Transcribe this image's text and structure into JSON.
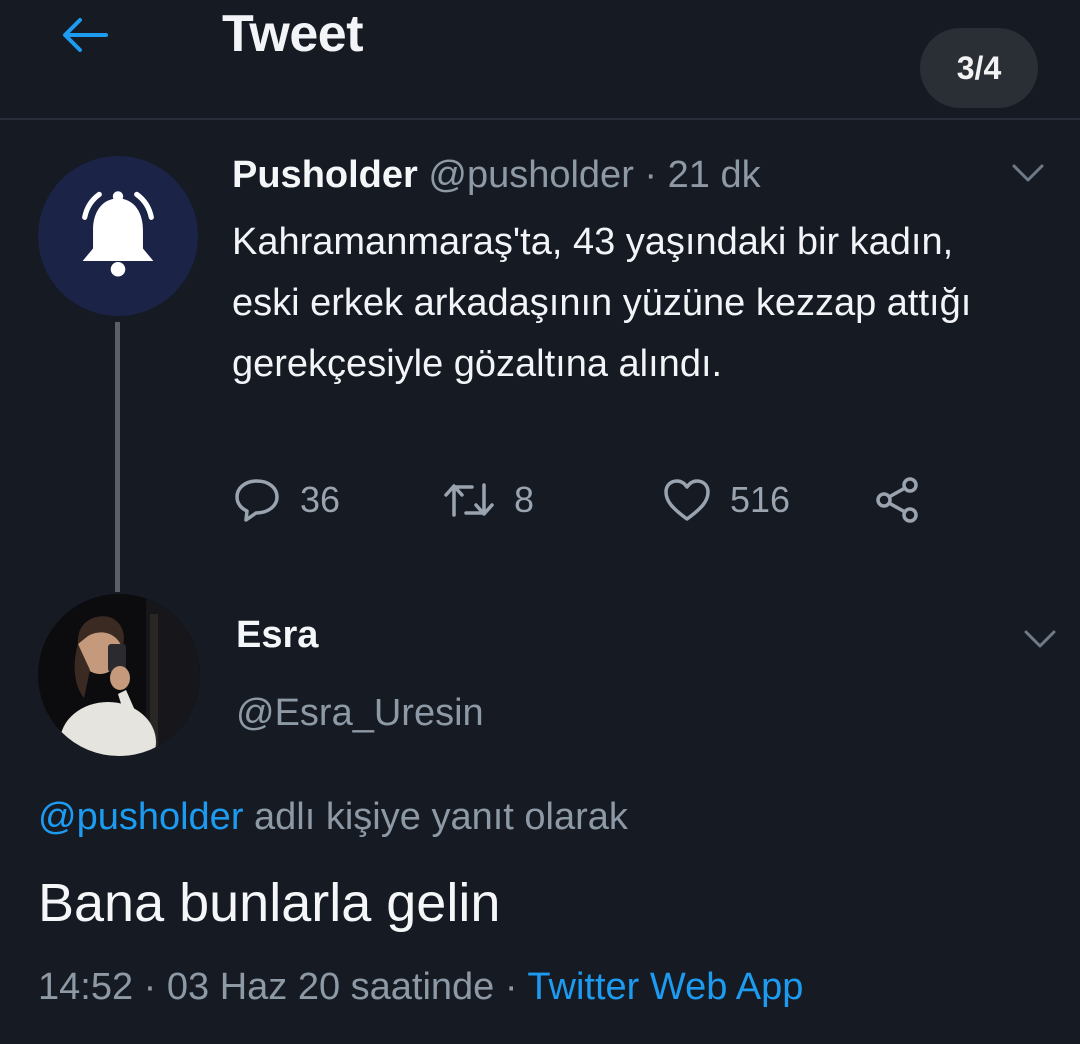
{
  "header": {
    "title": "Tweet",
    "page_indicator": "3/4",
    "accent_color": "#1d9bf0"
  },
  "parent_tweet": {
    "author_name": "Pusholder",
    "author_handle": "@pusholder",
    "separator": "·",
    "time_ago": "21 dk",
    "avatar_icon": "bell-icon",
    "text": "Kahramanmaraş'ta, 43 yaşındaki bir kadın, eski erkek arkadaşının yüzüne kezzap attığı gerekçesiyle gözaltına alındı.",
    "reply_count": "36",
    "retweet_count": "8",
    "like_count": "516"
  },
  "reply_tweet": {
    "author_name": "Esra",
    "author_handle": "@Esra_Uresin",
    "reply_to_mention": "@pusholder",
    "reply_to_suffix": " adlı kişiye yanıt olarak",
    "text": "Bana bunlarla gelin",
    "timestamp": "14:52 · 03 Haz 20 saatinde",
    "separator": " · ",
    "source": "Twitter Web App"
  }
}
